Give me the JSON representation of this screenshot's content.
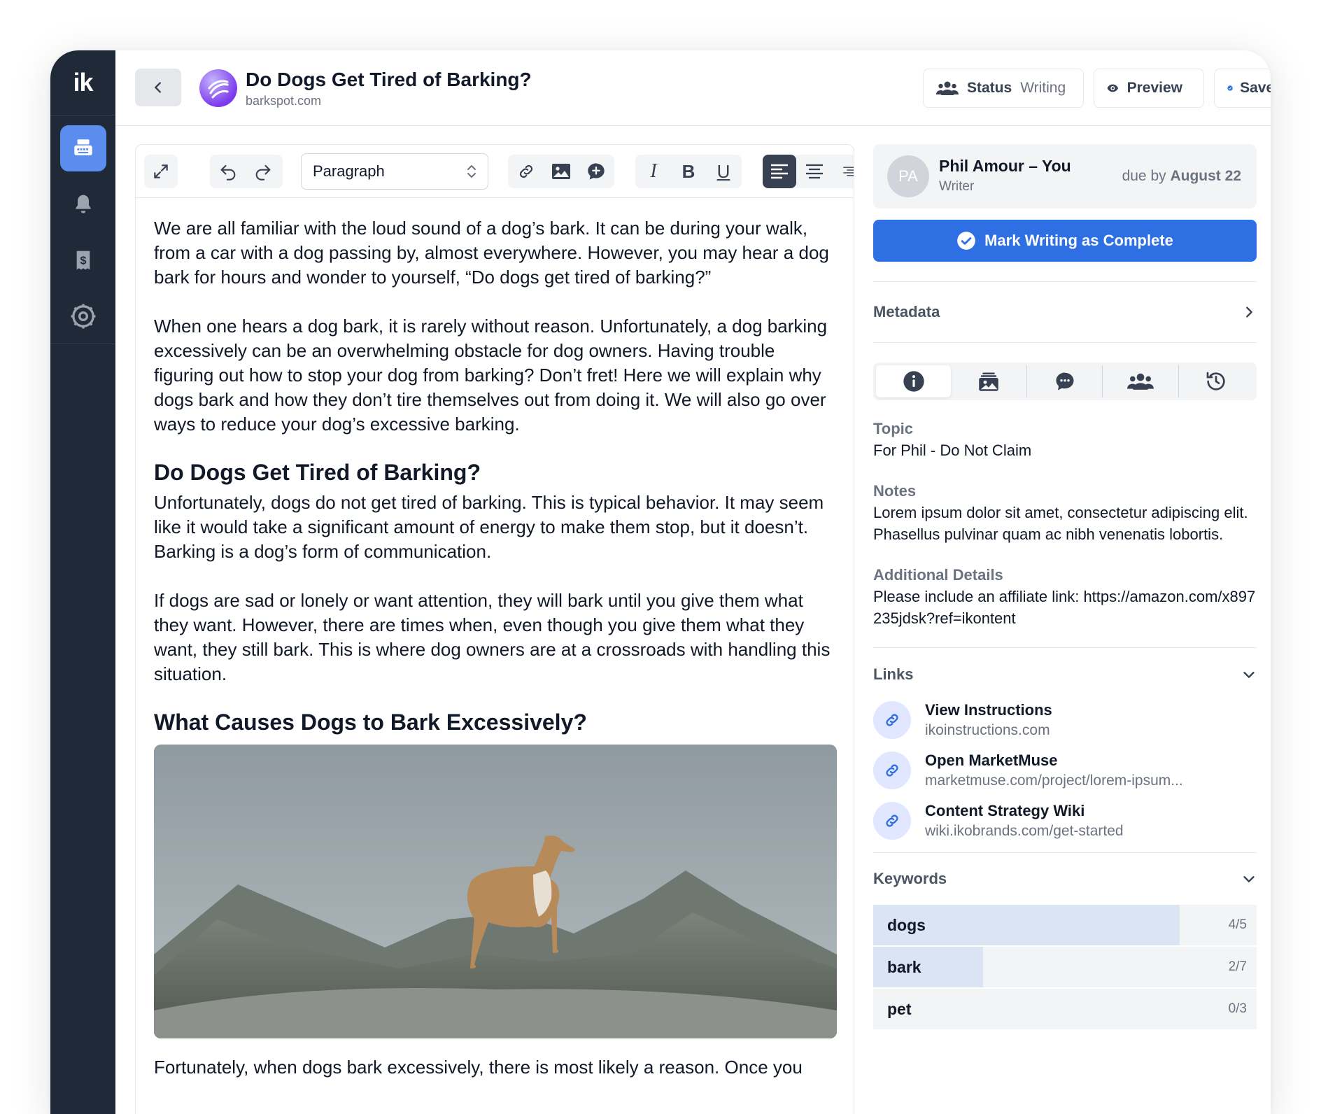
{
  "app": {
    "logo": "ik"
  },
  "sidebar": {
    "items": [
      {
        "name": "sidebar-item-editor",
        "icon": "typewriter-icon",
        "active": true
      },
      {
        "name": "sidebar-item-notifications",
        "icon": "bell-icon",
        "active": false
      },
      {
        "name": "sidebar-item-billing",
        "icon": "receipt-icon",
        "active": false
      },
      {
        "name": "sidebar-item-settings",
        "icon": "gear-icon",
        "active": false
      }
    ]
  },
  "header": {
    "title": "Do Dogs Get Tired of Barking?",
    "site": "barkspot.com",
    "status_label": "Status",
    "status_value": "Writing",
    "preview_label": "Preview",
    "saved_label": "Saved"
  },
  "toolbar": {
    "block_type": "Paragraph"
  },
  "document": {
    "p1": "We are all familiar with the loud sound of a dog’s bark. It can be during your walk, from a car with a dog passing by, almost everywhere. However, you may hear a dog bark for hours and wonder to yourself, “Do dogs get tired of barking?”",
    "p2": "When one hears a dog bark, it is rarely without reason. Unfortunately, a dog barking excessively can be an overwhelming obstacle for dog owners. Having trouble figuring out how to stop your dog from barking? Don’t fret! Here we will explain why dogs bark and how they don’t tire themselves out from doing it. We will also go over ways to reduce your dog’s excessive barking.",
    "h1": "Do Dogs Get Tired of Barking?",
    "p3": "Unfortunately, dogs do not get tired of barking. This is typical behavior. It may seem like it would take a significant amount of energy to make them stop, but it doesn’t. Barking is a dog’s form of communication.",
    "p4": "If dogs are sad or lonely or want attention, they will bark until you give them what they want. However, there are times when, even though you give them what they want, they still bark. This is where dog owners are at a crossroads with handling this situation.",
    "h2": "What Causes Dogs to Bark Excessively?",
    "p5": "Fortunately, when dogs bark excessively, there is most likely a reason. Once you"
  },
  "assignee": {
    "initials": "PA",
    "name": "Phil Amour – You",
    "role": "Writer",
    "due_prefix": "due by",
    "due_date": "August 22"
  },
  "actions": {
    "complete_label": "Mark Writing as Complete"
  },
  "metadata": {
    "label": "Metadata"
  },
  "tabs": [
    {
      "name": "tab-info",
      "icon": "info-icon"
    },
    {
      "name": "tab-media",
      "icon": "image-stack-icon"
    },
    {
      "name": "tab-comments",
      "icon": "comment-icon"
    },
    {
      "name": "tab-team",
      "icon": "users-icon"
    },
    {
      "name": "tab-history",
      "icon": "history-icon"
    }
  ],
  "info": {
    "topic_label": "Topic",
    "topic_value": "For Phil - Do Not Claim",
    "notes_label": "Notes",
    "notes_value": "Lorem ipsum dolor sit amet, consectetur adipiscing elit. Phasellus pulvinar quam ac nibh venenatis lobortis.",
    "details_label": "Additional Details",
    "details_value": "Please include an affiliate link: https://amazon.com/x897235jdsk?ref=ikontent"
  },
  "links": {
    "label": "Links",
    "items": [
      {
        "title": "View Instructions",
        "url": "ikoinstructions.com"
      },
      {
        "title": "Open MarketMuse",
        "url": "marketmuse.com/project/lorem-ipsum..."
      },
      {
        "title": "Content Strategy Wiki",
        "url": "wiki.ikobrands.com/get-started"
      }
    ]
  },
  "keywords": {
    "label": "Keywords",
    "items": [
      {
        "word": "dogs",
        "count": "4/5",
        "fill": 0.8
      },
      {
        "word": "bark",
        "count": "2/7",
        "fill": 0.2857
      },
      {
        "word": "pet",
        "count": "0/3",
        "fill": 0
      }
    ]
  },
  "colors": {
    "accent": "#2f6fe4",
    "sidebar": "#1f2937",
    "active_nav": "#5b8def"
  }
}
